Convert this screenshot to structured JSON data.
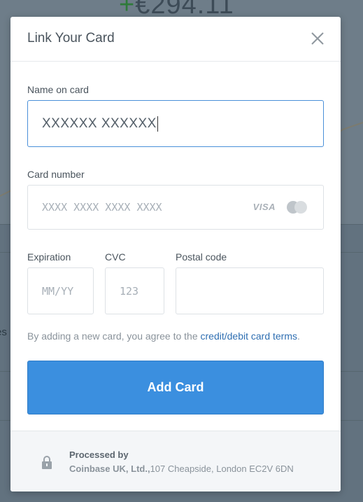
{
  "background": {
    "amount_plus": "+",
    "amount": "€294.11",
    "side_text": "es"
  },
  "modal": {
    "title": "Link Your Card",
    "close_icon": "close-icon",
    "name_field": {
      "label": "Name on card",
      "value": "XXXXXX XXXXXX"
    },
    "card_number_field": {
      "label": "Card number",
      "placeholder": "XXXX XXXX XXXX XXXX",
      "visa_label": "VISA",
      "mastercard_icon": "mastercard-icon"
    },
    "expiration_field": {
      "label": "Expiration",
      "placeholder": "MM/YY"
    },
    "cvc_field": {
      "label": "CVC",
      "placeholder": "123"
    },
    "postal_field": {
      "label": "Postal code",
      "value": ""
    },
    "terms": {
      "prefix": "By adding a new card, you agree to the ",
      "link": "credit/debit card terms",
      "suffix": "."
    },
    "add_button": "Add Card",
    "footer": {
      "lock_icon": "lock-icon",
      "processed_by": "Processed by",
      "company": "Coinbase UK, Ltd.,",
      "address": "107 Cheapside, London EC2V 6DN"
    }
  },
  "colors": {
    "accent": "#3b8fdf",
    "link": "#2f6fb2",
    "overlay": "#62727f"
  }
}
